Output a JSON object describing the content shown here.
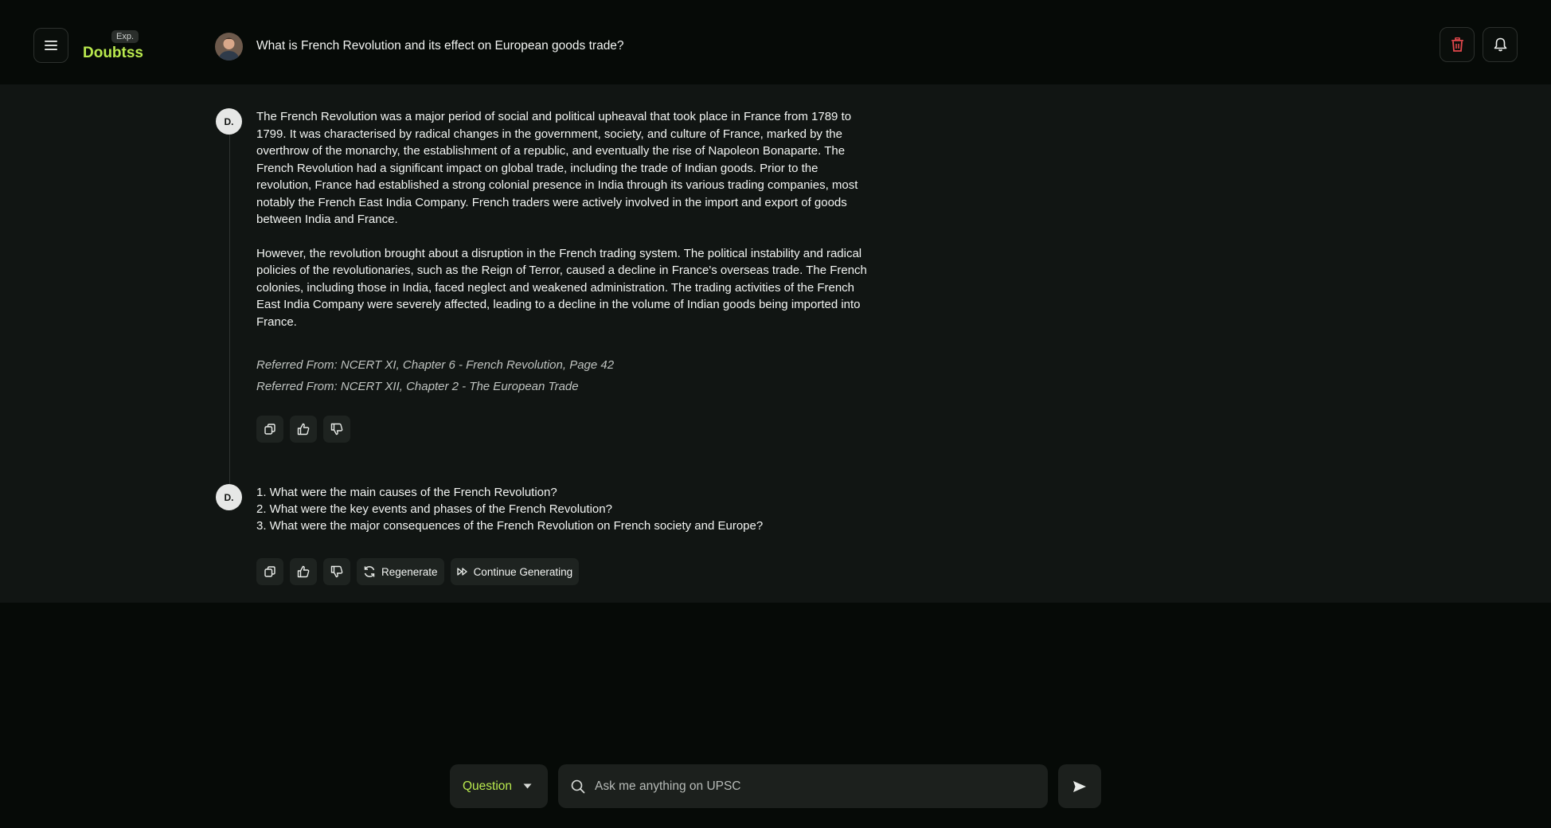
{
  "header": {
    "brand_badge": "Exp.",
    "brand_name": "Doubtss",
    "question": "What is French Revolution and its effect on European goods trade?"
  },
  "answer": {
    "avatar_label": "D.",
    "paragraphs": [
      "The French Revolution was a major period of social and political upheaval that took place in France from 1789 to 1799. It was characterised by radical changes in the government, society, and culture of France, marked by the overthrow of the monarchy, the establishment of a republic, and eventually the rise of Napoleon Bonaparte. The French Revolution had a significant impact on global trade, including the trade of Indian goods. Prior to the revolution, France had established a strong colonial presence in India through its various trading companies, most notably the French East India Company. French traders were actively involved in the import and export of goods between India and France.",
      "However, the revolution brought about a disruption in the French trading system. The political instability and radical policies of the revolutionaries, such as the Reign of Terror, caused a decline in France's overseas trade. The French colonies, including those in India, faced neglect and weakened administration. The trading activities of the French East India Company were severely affected, leading to a decline in the volume of Indian goods being imported into France."
    ],
    "references": [
      "Referred From: NCERT XI, Chapter 6 - French Revolution, Page 42",
      "Referred From: NCERT XII, Chapter 2 - The European Trade"
    ]
  },
  "followup": {
    "avatar_label": "D.",
    "items": [
      "1. What were the main causes of the French Revolution?",
      "2. What were the key events and phases of the French Revolution?",
      "3. What were the major consequences of the French Revolution on French society and Europe?"
    ],
    "regenerate_label": "Regenerate",
    "continue_label": "Continue Generating"
  },
  "input": {
    "mode": "Question",
    "placeholder": "Ask me anything on UPSC"
  },
  "colors": {
    "accent": "#b9e94e",
    "delete": "#e5484d",
    "background": "#060a07",
    "chat_background": "#111513"
  }
}
